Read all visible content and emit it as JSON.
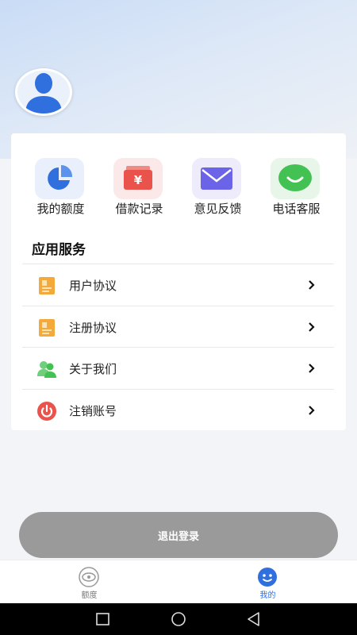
{
  "profile": {
    "avatar_icon": "user-avatar-icon"
  },
  "quick_actions": [
    {
      "label": "我的额度",
      "icon": "pie-chart-icon",
      "color": "#2f6fde"
    },
    {
      "label": "借款记录",
      "icon": "yuan-wallet-icon",
      "color": "#e9534b"
    },
    {
      "label": "意见反馈",
      "icon": "envelope-icon",
      "color": "#6b63e8"
    },
    {
      "label": "电话客服",
      "icon": "chat-bubble-icon",
      "color": "#43c253"
    }
  ],
  "services": {
    "title": "应用服务",
    "items": [
      {
        "label": "用户协议",
        "icon": "document-icon"
      },
      {
        "label": "注册协议",
        "icon": "document-icon"
      },
      {
        "label": "关于我们",
        "icon": "users-icon"
      },
      {
        "label": "注销账号",
        "icon": "power-icon"
      }
    ]
  },
  "logout_label": "退出登录",
  "tabbar": [
    {
      "label": "额度",
      "icon": "eye-icon",
      "active": false
    },
    {
      "label": "我的",
      "icon": "smiley-icon",
      "active": true
    }
  ],
  "colors": {
    "accent": "#2f6fde",
    "logout_button": "#9a9a9a"
  }
}
